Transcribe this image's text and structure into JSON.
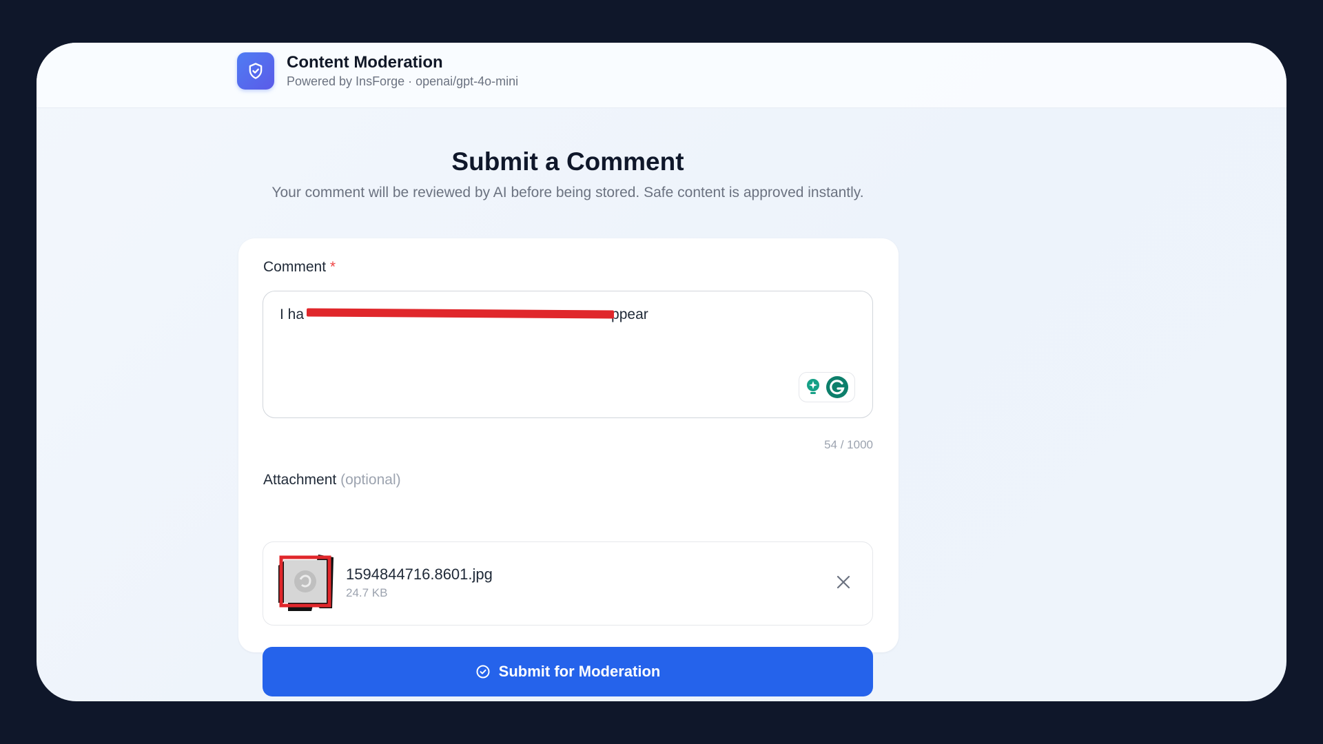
{
  "app": {
    "title": "Content Moderation",
    "subtitle": "Powered by InsForge · openai/gpt-4o-mini",
    "logo_icon": "shield-check-icon"
  },
  "page": {
    "heading": "Submit a Comment",
    "description": "Your comment will be reviewed by AI before being stored. Safe content is approved instantly."
  },
  "form": {
    "comment_label": "Comment",
    "required_marker": "*",
    "comment_value_visible_start": "I ha",
    "comment_value_visible_end": "ppear",
    "comment_redacted": true,
    "char_count": "54 / 1000",
    "attachment_label": "Attachment",
    "attachment_hint": "(optional)",
    "attachment": {
      "file_name": "1594844716.8601.jpg",
      "file_size": "24.7 KB"
    },
    "submit_label": "Submit for Moderation",
    "submit_icon": "check-circle-icon"
  },
  "colors": {
    "background": "#0f172a",
    "accent": "#2563eb",
    "required": "#ef4444",
    "redaction": "#e0272b",
    "grammarly": "#15a086"
  }
}
